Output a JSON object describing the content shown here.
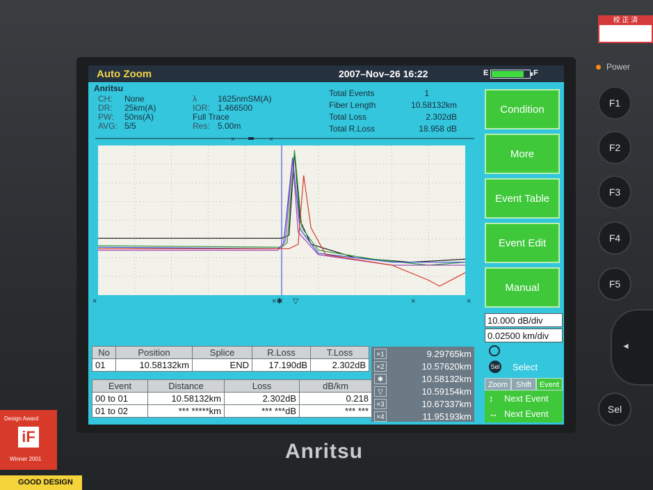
{
  "device": {
    "brand": "Anritsu",
    "power_label": "Power",
    "function_keys": [
      "F1",
      "F2",
      "F3",
      "F4",
      "F5"
    ],
    "sel_key": "Sel",
    "award_label": "Design Award",
    "award_badge": "iF",
    "award_year": "Winner 2001",
    "good_design": "GOOD DESIGN",
    "cal_label": "校 正 済",
    "dpad_arrow": "◄"
  },
  "titlebar": {
    "app_title": "Auto Zoom",
    "datetime": "2007–Nov–26 16:22",
    "battery_e": "E",
    "battery_f": "F",
    "battery_level": 0.85
  },
  "info": {
    "vendor": "Anritsu",
    "ch_label": "CH:",
    "ch_value": "None",
    "dr_label": "DR:",
    "dr_value": "25km(A)",
    "pw_label": "PW:",
    "pw_value": "50ns(A)",
    "avg_label": "AVG:",
    "avg_value": "5/5",
    "lambda_label": "λ",
    "lambda_value": "1625nmSM(A)",
    "ior_label": "IOR:",
    "ior_value": "1.466500",
    "trace_value": "Full Trace",
    "res_label": "Res:",
    "res_value": "5.00m"
  },
  "summary": {
    "total_events_label": "Total Events",
    "total_events_value": "1",
    "fiber_length_label": "Fiber Length",
    "fiber_length_value": "10.58132km",
    "total_loss_label": "Total Loss",
    "total_loss_value": "2.302dB",
    "total_rloss_label": "Total R.Loss",
    "total_rloss_value": "18.958 dB"
  },
  "side_buttons": [
    "Condition",
    "More",
    "Event Table",
    "Event Edit",
    "Manual"
  ],
  "scale": {
    "db_div": "10.000 dB/div",
    "km_div": "0.02500 km/div"
  },
  "select": {
    "label": "Select",
    "sel_icon": "Sel"
  },
  "tabs": [
    {
      "label": "Zoom"
    },
    {
      "label": "Shift"
    },
    {
      "label": "Event"
    }
  ],
  "nav": {
    "next_up": "Next Event",
    "next_lr": "Next Event",
    "up_down_glyph": "↕",
    "left_right_glyph": "↔"
  },
  "event_table": {
    "headers": [
      "No",
      "Position",
      "Splice",
      "R.Loss",
      "T.Loss"
    ],
    "rows": [
      [
        "01",
        "10.58132km",
        "END",
        "17.190dB",
        "2.302dB"
      ]
    ]
  },
  "section_table": {
    "headers": [
      "Event",
      "Distance",
      "Loss",
      "dB/km"
    ],
    "rows": [
      [
        "00 to 01",
        "10.58132km",
        "2.302dB",
        "0.218"
      ],
      [
        "01 to 02",
        "*** *****km",
        "*** ***dB",
        "*** ***"
      ]
    ]
  },
  "markers": [
    {
      "icon": "×1",
      "value": "9.29765km"
    },
    {
      "icon": "×2",
      "value": "10.57620km"
    },
    {
      "icon": "✱",
      "value": "10.58132km"
    },
    {
      "icon": "▽",
      "value": "10.59154km"
    },
    {
      "icon": "×3",
      "value": "10.67337km"
    },
    {
      "icon": "×4",
      "value": "11.95193km"
    }
  ],
  "trace_colors": {
    "green": "#2e9a3a",
    "blue": "#3a4fd6",
    "red": "#d63a2a",
    "purple": "#a04ab8",
    "black": "#1a1a1a"
  },
  "chart_data": {
    "type": "line",
    "grid": true,
    "series": [
      {
        "color": "#1a1a1a",
        "points": [
          [
            0,
            0.38
          ],
          [
            0.5,
            0.38
          ],
          [
            0.52,
            0.4
          ],
          [
            0.535,
            0.95
          ],
          [
            0.55,
            0.5
          ],
          [
            0.58,
            0.34
          ],
          [
            0.7,
            0.25
          ],
          [
            0.85,
            0.22
          ],
          [
            1,
            0.24
          ]
        ]
      },
      {
        "color": "#2e9a3a",
        "points": [
          [
            0,
            0.33
          ],
          [
            0.5,
            0.32
          ],
          [
            0.515,
            0.35
          ],
          [
            0.535,
            0.97
          ],
          [
            0.555,
            0.45
          ],
          [
            0.6,
            0.3
          ],
          [
            0.75,
            0.24
          ],
          [
            0.9,
            0.2
          ],
          [
            1,
            0.22
          ]
        ]
      },
      {
        "color": "#3a4fd6",
        "points": [
          [
            0,
            0.32
          ],
          [
            0.49,
            0.31
          ],
          [
            0.505,
            0.34
          ],
          [
            0.53,
            0.92
          ],
          [
            0.55,
            0.44
          ],
          [
            0.6,
            0.28
          ],
          [
            0.8,
            0.22
          ],
          [
            1,
            0.22
          ]
        ]
      },
      {
        "color": "#a04ab8",
        "points": [
          [
            0,
            0.3
          ],
          [
            0.49,
            0.3
          ],
          [
            0.51,
            0.36
          ],
          [
            0.53,
            0.9
          ],
          [
            0.545,
            0.42
          ],
          [
            0.6,
            0.27
          ],
          [
            0.8,
            0.2
          ],
          [
            1,
            0.2
          ]
        ]
      },
      {
        "color": "#d63a2a",
        "points": [
          [
            0,
            0.31
          ],
          [
            0.52,
            0.31
          ],
          [
            0.545,
            0.34
          ],
          [
            0.56,
            0.8
          ],
          [
            0.58,
            0.45
          ],
          [
            0.62,
            0.27
          ],
          [
            0.8,
            0.2
          ],
          [
            0.9,
            0.1
          ],
          [
            0.93,
            0.06
          ],
          [
            1,
            0.15
          ]
        ]
      }
    ]
  }
}
